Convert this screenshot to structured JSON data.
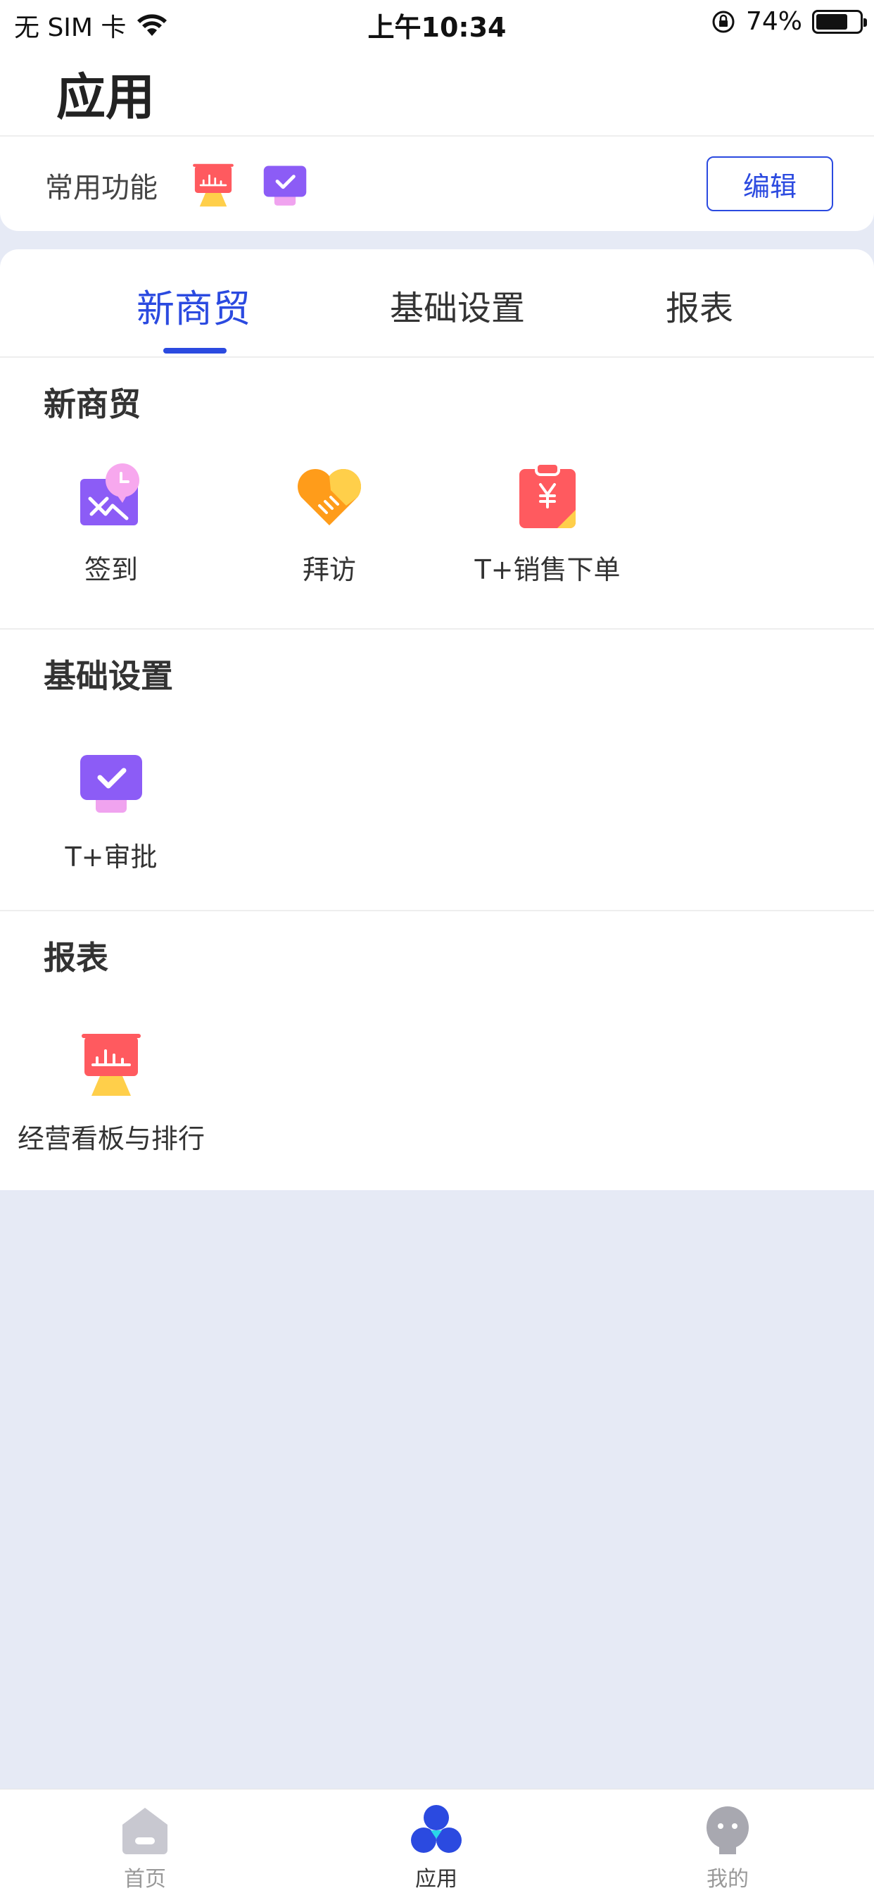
{
  "status_bar": {
    "carrier": "无 SIM 卡",
    "time": "上午10:34",
    "battery": "74%",
    "battery_level": 0.74
  },
  "header": {
    "title": "应用",
    "favorites_label": "常用功能",
    "edit_label": "编辑",
    "favorite_icons": [
      "dashboard-board-icon",
      "approval-check-icon"
    ]
  },
  "tabs": [
    {
      "label": "新商贸",
      "active": true
    },
    {
      "label": "基础设置",
      "active": false
    },
    {
      "label": "报表",
      "active": false
    }
  ],
  "sections": [
    {
      "title": "新商贸",
      "apps": [
        {
          "label": "签到",
          "icon": "checkin-map-pin-icon"
        },
        {
          "label": "拜访",
          "icon": "handshake-heart-icon"
        },
        {
          "label": "T+销售下单",
          "icon": "sales-order-yen-icon"
        }
      ]
    },
    {
      "title": "基础设置",
      "apps": [
        {
          "label": "T+审批",
          "icon": "approval-check-icon"
        }
      ]
    },
    {
      "title": "报表",
      "apps": [
        {
          "label": "经营看板与排行",
          "icon": "dashboard-board-icon"
        }
      ]
    }
  ],
  "bottom_nav": [
    {
      "label": "首页",
      "icon": "home-icon",
      "active": false
    },
    {
      "label": "应用",
      "icon": "apps-dots-icon",
      "active": true
    },
    {
      "label": "我的",
      "icon": "profile-icon",
      "active": false
    }
  ],
  "colors": {
    "accent": "#2b4ae0",
    "background": "#e6eaf5",
    "purple": "#8c5cf6",
    "red": "#ff5a5f",
    "orange": "#ff9c1a"
  }
}
